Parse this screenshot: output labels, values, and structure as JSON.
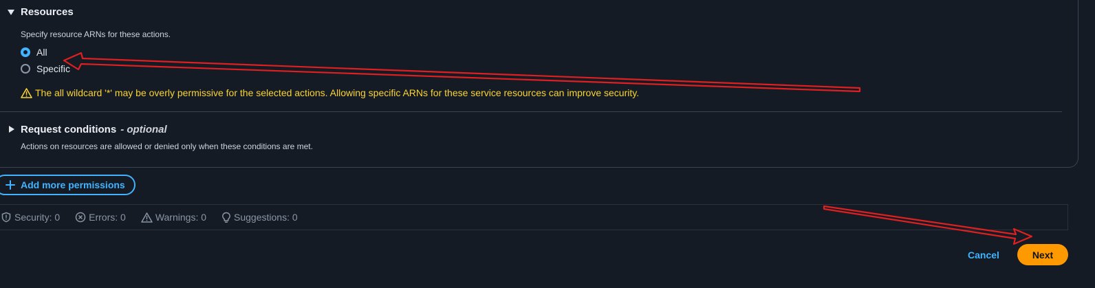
{
  "resources": {
    "title": "Resources",
    "description": "Specify resource ARNs for these actions.",
    "options": [
      {
        "label": "All",
        "checked": true
      },
      {
        "label": "Specific",
        "checked": false
      }
    ],
    "warning": "The all wildcard '*' may be overly permissive for the selected actions. Allowing specific ARNs for these service resources can improve security."
  },
  "request_conditions": {
    "title": "Request conditions",
    "optional": "- optional",
    "description": "Actions on resources are allowed or denied only when these conditions are met."
  },
  "add_permissions": {
    "label": "Add more permissions"
  },
  "status": {
    "security": "Security: 0",
    "errors": "Errors: 0",
    "warnings": "Warnings: 0",
    "suggestions": "Suggestions: 0"
  },
  "footer": {
    "cancel": "Cancel",
    "next": "Next"
  },
  "colors": {
    "accent": "#42b4ff",
    "warning": "#fbd332",
    "primary_button": "#ff9900",
    "annotation": "#e02020"
  }
}
